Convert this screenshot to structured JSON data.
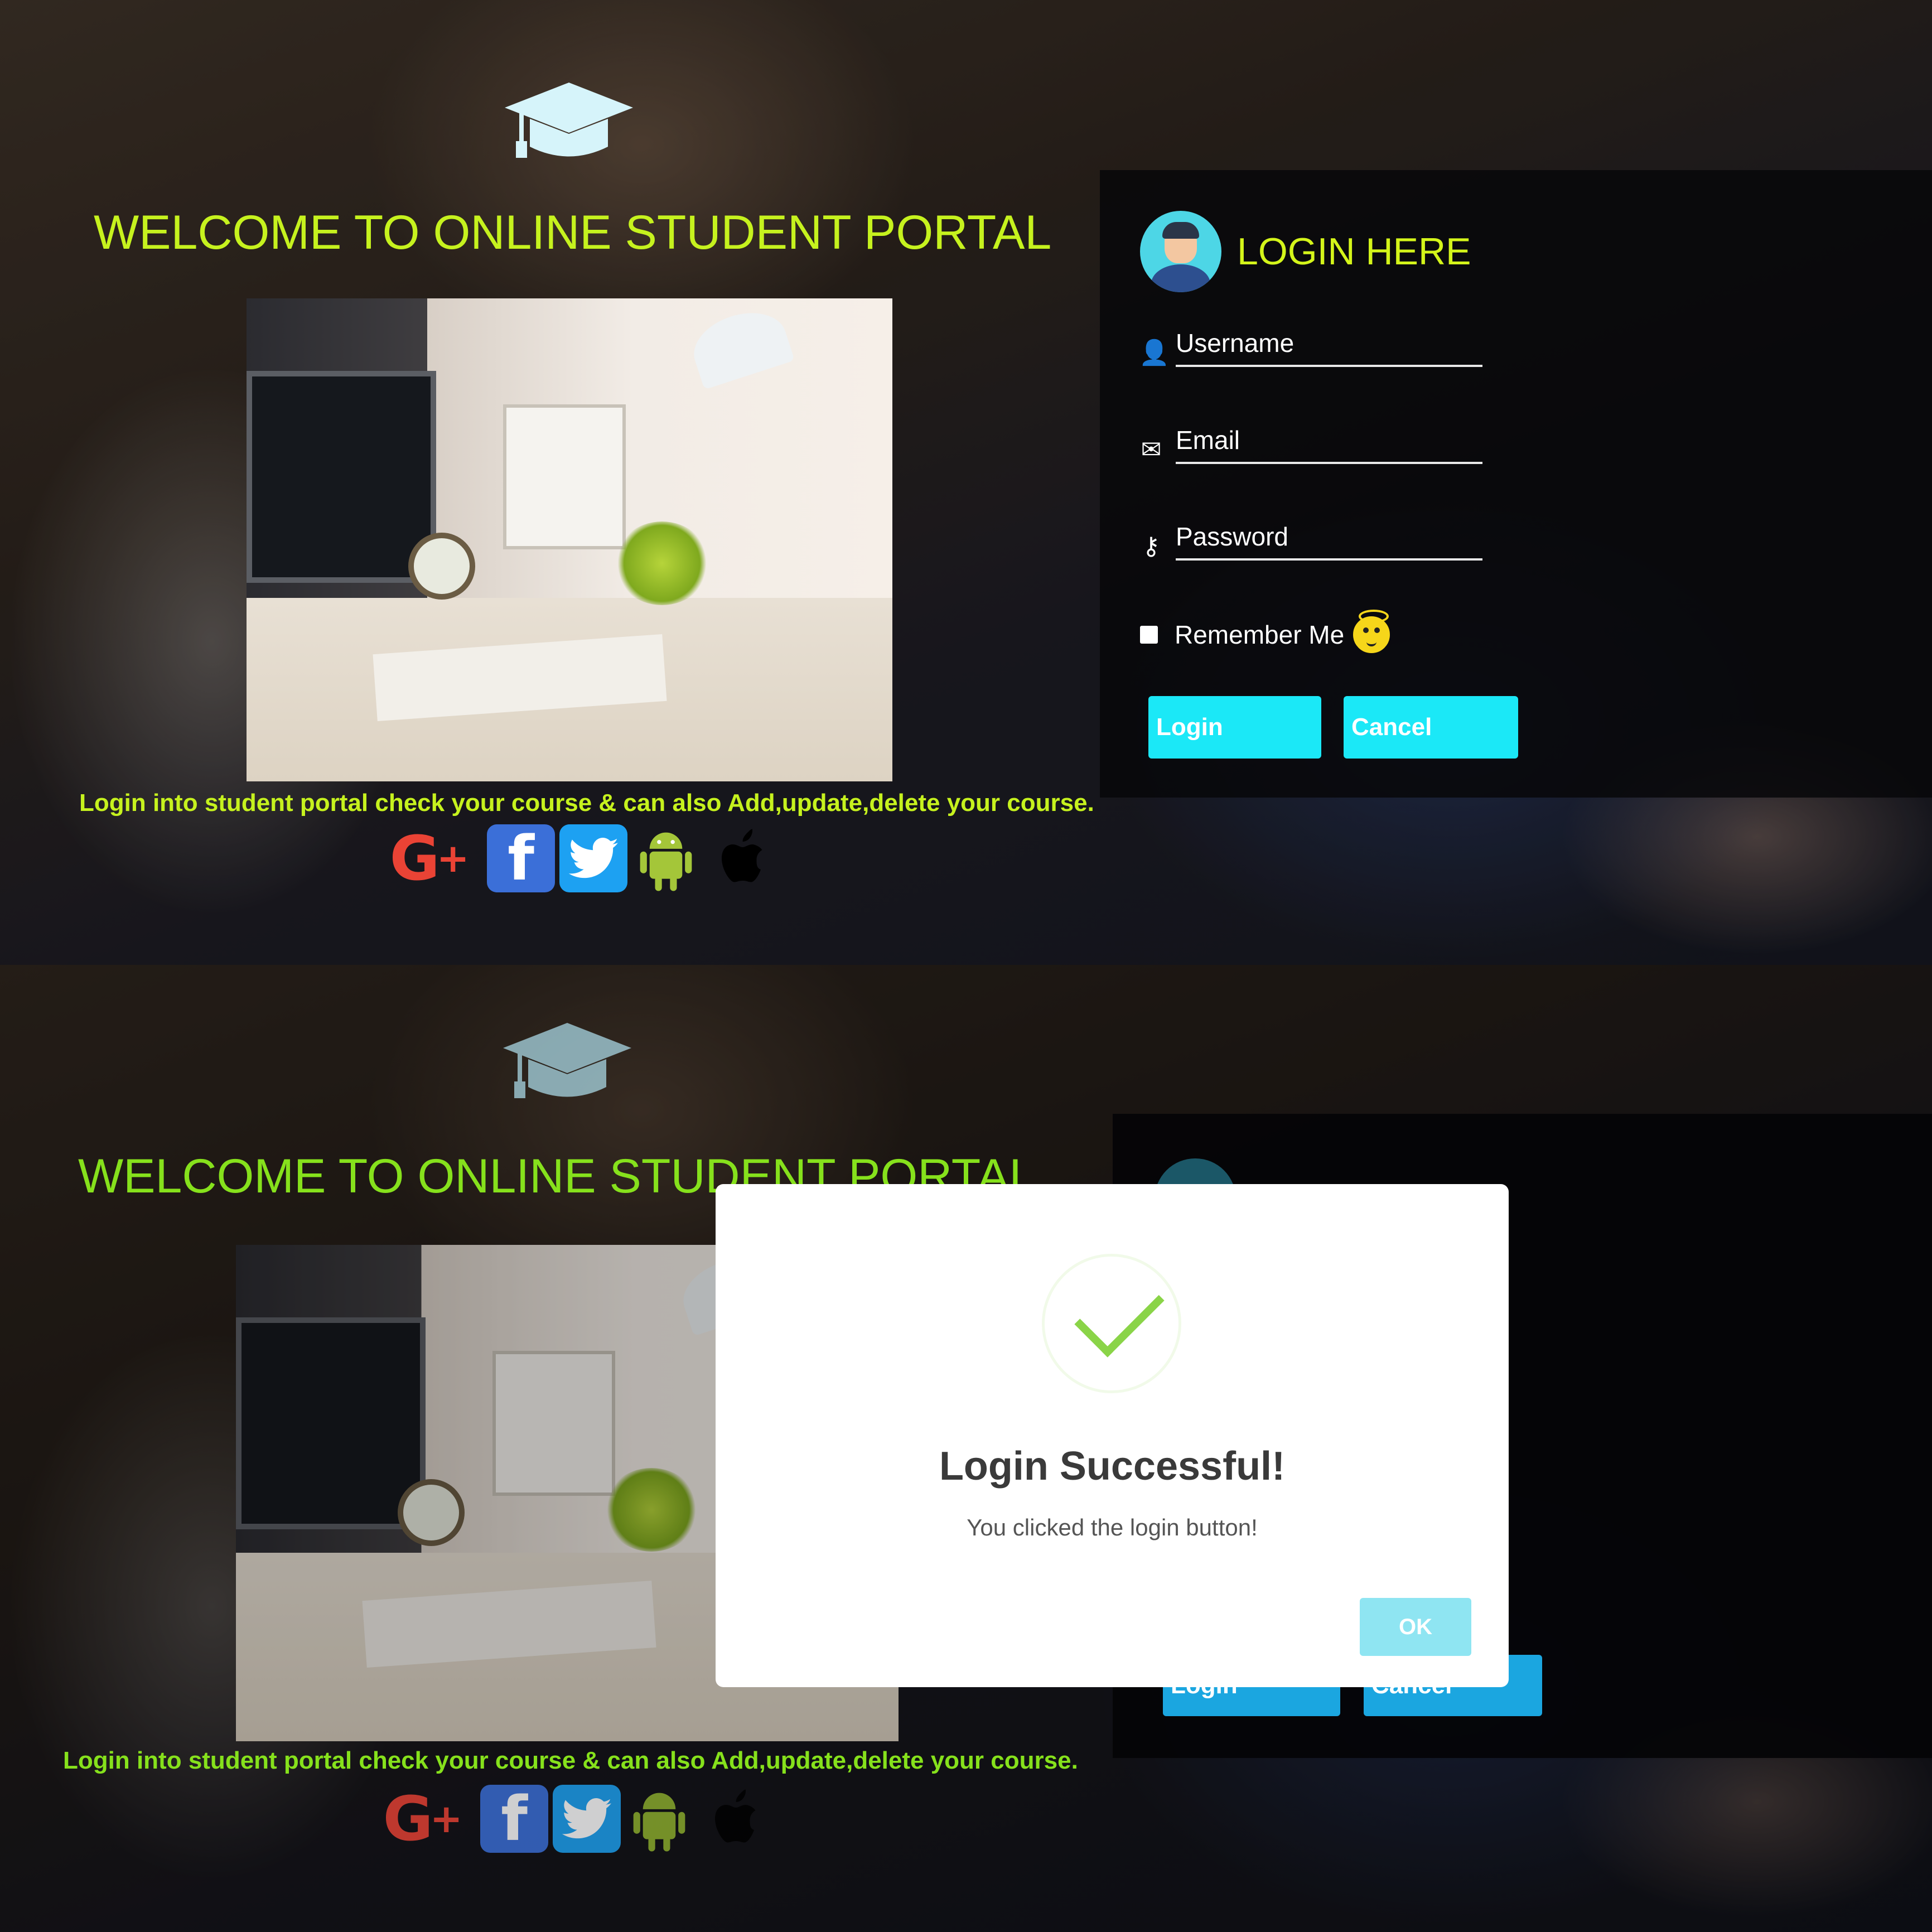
{
  "welcome_title": "WELCOME TO ONLINE STUDENT PORTAL",
  "tagline": "Login into student portal check your course & can also Add,update,delete your course.",
  "login": {
    "title": "LOGIN HERE",
    "username_label": "Username",
    "email_label": "Email",
    "password_label": "Password",
    "remember_label": "Remember Me",
    "login_button": "Login",
    "cancel_button": "Cancel"
  },
  "social_icons": [
    "google-plus-icon",
    "facebook-icon",
    "twitter-icon",
    "android-icon",
    "apple-icon"
  ],
  "modal": {
    "title": "Login Successful!",
    "message": "You clicked the login button!",
    "ok_button": "OK"
  },
  "colors": {
    "welcome_green": "#c6f21e",
    "welcome_green_dim": "#86e11c",
    "login_title": "#d4f51a",
    "button_cyan": "#1be8f7",
    "button_blue": "#1ba6e0",
    "check_green": "#8ad448",
    "ok_button": "#8fe5f2"
  }
}
